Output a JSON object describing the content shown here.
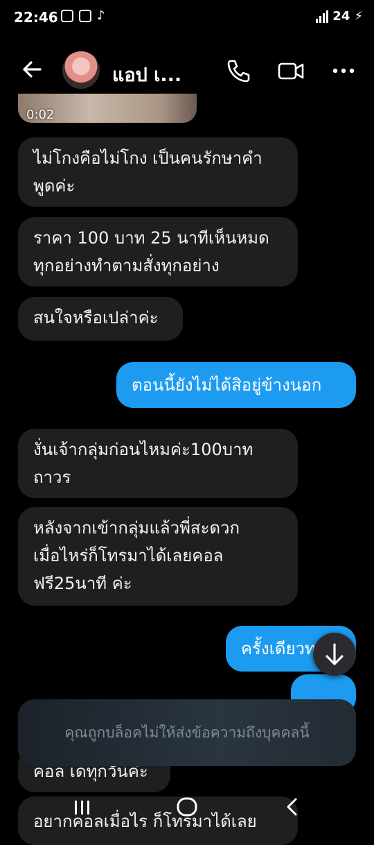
{
  "status_bar": {
    "time": "22:46",
    "battery": "24"
  },
  "header": {
    "contact_name": "แอป เ..."
  },
  "video": {
    "duration": "0:02"
  },
  "messages": [
    {
      "text": "ไม่โกงคือไม่โกง เป็นคนรักษาคำ\nพูดค่ะ"
    },
    {
      "text": "ราคา 100 บาท 25 นาทีเห็นหมด\nทุกอย่างทำตามสั่งทุกอย่าง"
    },
    {
      "text": "สนใจหรือเปล่าค่ะ"
    },
    {
      "text": "ตอนนี้ยังไม่ได้สิอยู่ข้างนอก"
    },
    {
      "text": "งั่นเจ้ากลุ่มก่อนไหมค่ะ100บาท\nถาวร"
    },
    {
      "text": "หลังจากเข้ากลุ่มแล้วพี่สะดวก\nเมื่อไหร่ก็โทรมาได้เลยคอล\nฟรี25นาที ค่ะ"
    },
    {
      "text": "ครั้งเดียวท"
    },
    {
      "text": ""
    },
    {
      "text": "คอล เดทุกวันค่ะ"
    },
    {
      "text": "อยากคอลเมื่อไร ก็โทรมาได้เลย"
    }
  ],
  "toast": {
    "text": "คุณถูกบล็อคไม่ให้ส่งข้อความถึงบุคคลนี้"
  },
  "colors": {
    "background": "#000000",
    "incoming_bubble": "#1f1f22",
    "outgoing_bubble": "#1d9bf0"
  },
  "icons": [
    "back-arrow-icon",
    "phone-icon",
    "video-call-icon",
    "more-icon",
    "arrow-down-icon",
    "recents-icon",
    "home-icon",
    "nav-back-icon"
  ]
}
